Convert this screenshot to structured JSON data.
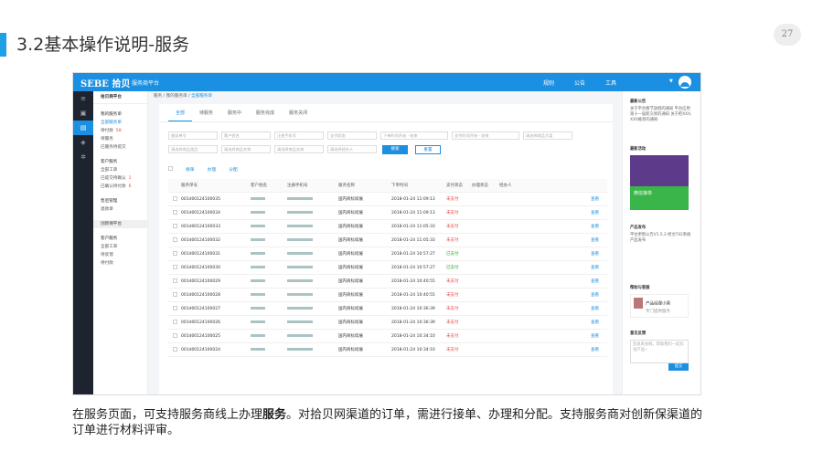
{
  "slide": {
    "title": "3.2基本操作说明-服务",
    "page_number": "27",
    "caption_pre": "在服务页面，可支持服务商线上办理",
    "caption_bold": "服务",
    "caption_post": "。对拾贝网渠道的订单，需进行接单、办理和分配。支持服务商对创新保渠道的订单进行材料评审。"
  },
  "app": {
    "logo": "SEBE 拾贝",
    "subtitle": "服务商平台",
    "nav": [
      "规则",
      "公告",
      "工具"
    ]
  },
  "leftnav": {
    "header": "拾贝商平台",
    "sections": [
      {
        "title": "我的服务单",
        "items": [
          {
            "label": "全部服务单",
            "active": true
          },
          {
            "label": "待付款",
            "badge": "58"
          },
          {
            "label": "待服务"
          },
          {
            "label": "已服务待提交"
          }
        ]
      },
      {
        "title": "客户服务",
        "items": [
          {
            "label": "全部工单"
          },
          {
            "label": "已提交待确认",
            "badge": "1"
          },
          {
            "label": "已确认待付款",
            "badge": "6"
          }
        ]
      },
      {
        "title": "售后管理",
        "items": [
          {
            "label": "退款单"
          }
        ]
      },
      {
        "title": "创新保平台",
        "items": []
      },
      {
        "title": "客户服务",
        "items": [
          {
            "label": "全部工单"
          },
          {
            "label": "待反馈"
          },
          {
            "label": "待付款"
          }
        ]
      }
    ]
  },
  "breadcrumb": [
    "服务",
    "我的服务单",
    "全部服务单"
  ],
  "tabs": [
    "全部",
    "待服务",
    "服务中",
    "服务完成",
    "服务关闭"
  ],
  "filters": {
    "row1": [
      "服务单号",
      "客户姓名",
      "注册手机号",
      "支付状态",
      "下单时间开始 - 结束",
      "支付时间开始 - 结束",
      "请选择商品大类"
    ],
    "row2": [
      "请选择商品类目",
      "请选择商品名称",
      "请选择商品名称",
      "请选择经办人"
    ],
    "search": "搜索",
    "reset": "重置"
  },
  "actions": [
    "接单",
    "办理",
    "分配"
  ],
  "table": {
    "headers": [
      "服务单号",
      "客户姓名",
      "注册手机号",
      "服务名称",
      "下单时间",
      "支付状态",
      "办理状态",
      "经办人",
      ""
    ],
    "rows": [
      {
        "id": "001d00124100035",
        "service": "国内商标续展",
        "time": "2018-01-24 11:09:13",
        "status": "未支付",
        "op": "查看"
      },
      {
        "id": "001d00124100034",
        "service": "国内商标续展",
        "time": "2018-01-24 11:09:13",
        "status": "未支付",
        "op": "查看"
      },
      {
        "id": "001d00124100033",
        "service": "国内商标续展",
        "time": "2018-01-24 11:05:33",
        "status": "未支付",
        "op": "查看"
      },
      {
        "id": "001d00124100032",
        "service": "国内商标续展",
        "time": "2018-01-24 11:05:33",
        "status": "未支付",
        "op": "查看"
      },
      {
        "id": "001d00124100031",
        "service": "国内商标续展",
        "time": "2018-01-24 10:57:27",
        "status": "已支付",
        "op": "查看"
      },
      {
        "id": "001d00124100030",
        "service": "国内商标续展",
        "time": "2018-01-24 10:57:27",
        "status": "已支付",
        "op": "查看"
      },
      {
        "id": "001d00124100029",
        "service": "国内商标续展",
        "time": "2018-01-24 10:40:55",
        "status": "未支付",
        "op": "查看"
      },
      {
        "id": "001d00124100028",
        "service": "国内商标续展",
        "time": "2018-01-24 10:40:55",
        "status": "未支付",
        "op": "查看"
      },
      {
        "id": "001d00124100027",
        "service": "国内商标续展",
        "time": "2018-01-24 10:36:39",
        "status": "未支付",
        "op": "查看"
      },
      {
        "id": "001d00124100026",
        "service": "国内商标续展",
        "time": "2018-01-24 10:36:39",
        "status": "未支付",
        "op": "查看"
      },
      {
        "id": "001d00124100025",
        "service": "国内商标续展",
        "time": "2018-01-24 10:34:10",
        "status": "未支付",
        "op": "查看"
      },
      {
        "id": "001d00124100024",
        "service": "国内商标续展",
        "time": "2018-01-24 10:34:10",
        "status": "未支付",
        "op": "查看"
      }
    ]
  },
  "right": {
    "notice_title": "最新公告",
    "notice_text": "关于平台春节放假的通知 平台应用第十一届新交易的通知 关于把XXX, XXX推荐的通知",
    "activity_title": "最新活动",
    "banner_text": "微信接单",
    "product_title": "产品发布",
    "product_text": "平台更新公告V1.5.3 修文T42系统产品发布",
    "contact_title": "帮助与客服",
    "contact_name": "产品经理小唐",
    "contact_sub": "专门提供服务",
    "feedback_title": "意见反馈",
    "feedback_placeholder": "您说来会喊，帮助我们一起优化产品~",
    "submit": "提交"
  }
}
